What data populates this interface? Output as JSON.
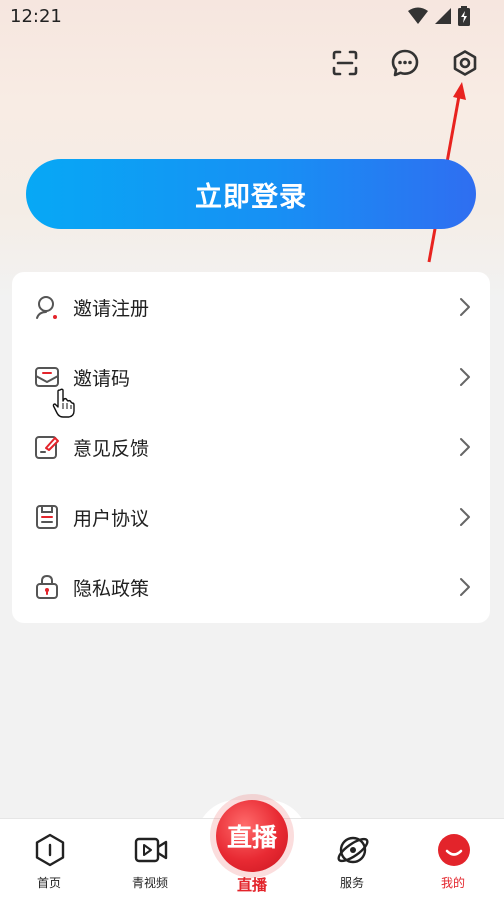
{
  "status_bar": {
    "time": "12:21"
  },
  "login_button": {
    "label": "立即登录"
  },
  "menu": [
    {
      "label": "邀请注册",
      "icon": "user-invite-icon"
    },
    {
      "label": "邀请码",
      "icon": "envelope-icon"
    },
    {
      "label": "意见反馈",
      "icon": "feedback-edit-icon"
    },
    {
      "label": "用户协议",
      "icon": "document-icon"
    },
    {
      "label": "隐私政策",
      "icon": "lock-icon"
    }
  ],
  "bottom_nav": {
    "home": "首页",
    "video": "青视频",
    "live_badge": "直播",
    "live": "直播",
    "service": "服务",
    "mine": "我的"
  },
  "colors": {
    "accent_red": "#e3242b",
    "login_gradient_start": "#07a8f5",
    "login_gradient_end": "#2f6ef1"
  }
}
